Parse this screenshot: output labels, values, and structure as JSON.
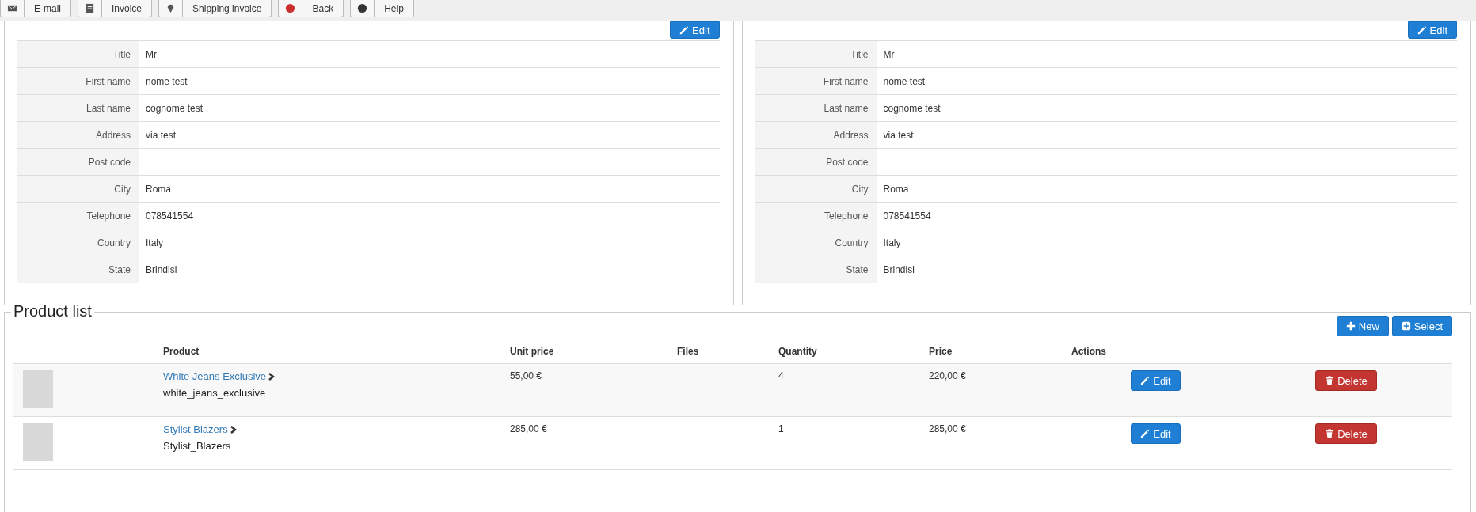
{
  "toolbar": [
    {
      "label": "E-mail",
      "kind": "mail"
    },
    {
      "label": "Invoice",
      "kind": "invoice"
    },
    {
      "label": "Shipping invoice",
      "kind": "shipping"
    },
    {
      "label": "Back",
      "kind": "back"
    },
    {
      "label": "Help",
      "kind": "help"
    }
  ],
  "addresses": [
    {
      "edit_button": "Edit",
      "fields": [
        {
          "label": "Title",
          "value": "Mr"
        },
        {
          "label": "First name",
          "value": "nome test"
        },
        {
          "label": "Last name",
          "value": "cognome test"
        },
        {
          "label": "Address",
          "value": "via test"
        },
        {
          "label": "Post code"
        },
        {
          "label": "City",
          "value": "Roma"
        },
        {
          "label": "Telephone",
          "value": "078541554"
        },
        {
          "label": "Country",
          "value": "Italy"
        },
        {
          "label": "State",
          "value": "Brindisi"
        }
      ]
    },
    {
      "edit_button": "Edit",
      "fields": [
        {
          "label": "Title",
          "value": "Mr"
        },
        {
          "label": "First name",
          "value": "nome test"
        },
        {
          "label": "Last name",
          "value": "cognome test"
        },
        {
          "label": "Address",
          "value": "via test"
        },
        {
          "label": "Post code"
        },
        {
          "label": "City",
          "value": "Roma"
        },
        {
          "label": "Telephone",
          "value": "078541554"
        },
        {
          "label": "Country",
          "value": "Italy"
        },
        {
          "label": "State",
          "value": "Brindisi"
        }
      ]
    }
  ],
  "product_list": {
    "legend": "Product list",
    "buttons": [
      {
        "label": "New",
        "kind": "new"
      },
      {
        "label": "Select",
        "kind": "select"
      }
    ],
    "columns": [
      "Product",
      "Unit price",
      "Files",
      "Quantity",
      "Price",
      "Actions"
    ],
    "rows": [
      {
        "name": "White Jeans Exclusive",
        "code": "white_jeans_exclusive",
        "unit_price": "55,00 €",
        "quantity": "4",
        "price": "220,00 €",
        "edit": "Edit",
        "delete": "Delete"
      },
      {
        "name": "Stylist Blazers",
        "code": "Stylist_Blazers",
        "unit_price": "285,00 €",
        "quantity": "1",
        "price": "285,00 €",
        "edit": "Edit",
        "delete": "Delete"
      }
    ]
  }
}
